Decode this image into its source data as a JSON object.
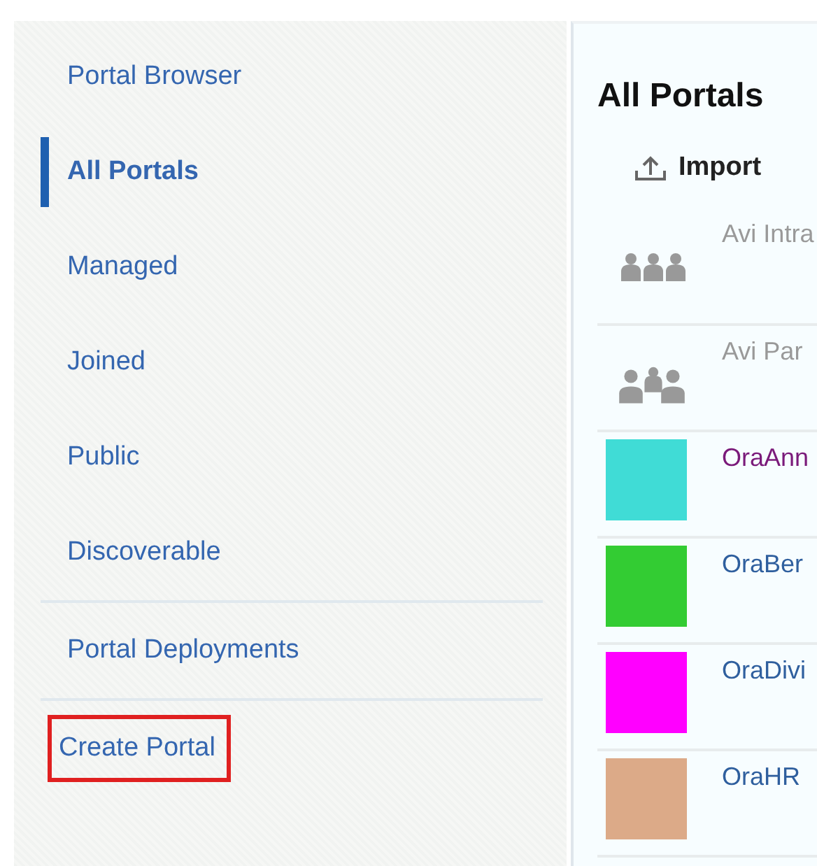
{
  "sidebar": {
    "groups": [
      {
        "items": [
          {
            "label": "Portal Browser",
            "selected": false,
            "focused": false
          },
          {
            "label": "All Portals",
            "selected": true,
            "focused": false
          },
          {
            "label": "Managed",
            "selected": false,
            "focused": false
          },
          {
            "label": "Joined",
            "selected": false,
            "focused": false
          },
          {
            "label": "Public",
            "selected": false,
            "focused": false
          },
          {
            "label": "Discoverable",
            "selected": false,
            "focused": false
          }
        ]
      },
      {
        "items": [
          {
            "label": "Portal Deployments",
            "selected": false,
            "focused": false
          }
        ]
      },
      {
        "items": [
          {
            "label": "Create Portal",
            "selected": false,
            "focused": true
          }
        ]
      }
    ]
  },
  "panel": {
    "title": "All Portals",
    "import_button": "Import",
    "portals": [
      {
        "kind": "group",
        "name": "Avi Intra",
        "visited": false
      },
      {
        "kind": "people",
        "name": "Avi Par",
        "visited": false
      },
      {
        "kind": "swatch",
        "color": "#40dcd6",
        "name": "OraAnn",
        "visited": true
      },
      {
        "kind": "swatch",
        "color": "#33cc33",
        "name": "OraBer",
        "visited": false
      },
      {
        "kind": "swatch",
        "color": "#ff00ff",
        "name": "OraDivi",
        "visited": false
      },
      {
        "kind": "swatch",
        "color": "#dcaa88",
        "name": "OraHR",
        "visited": false
      }
    ]
  }
}
